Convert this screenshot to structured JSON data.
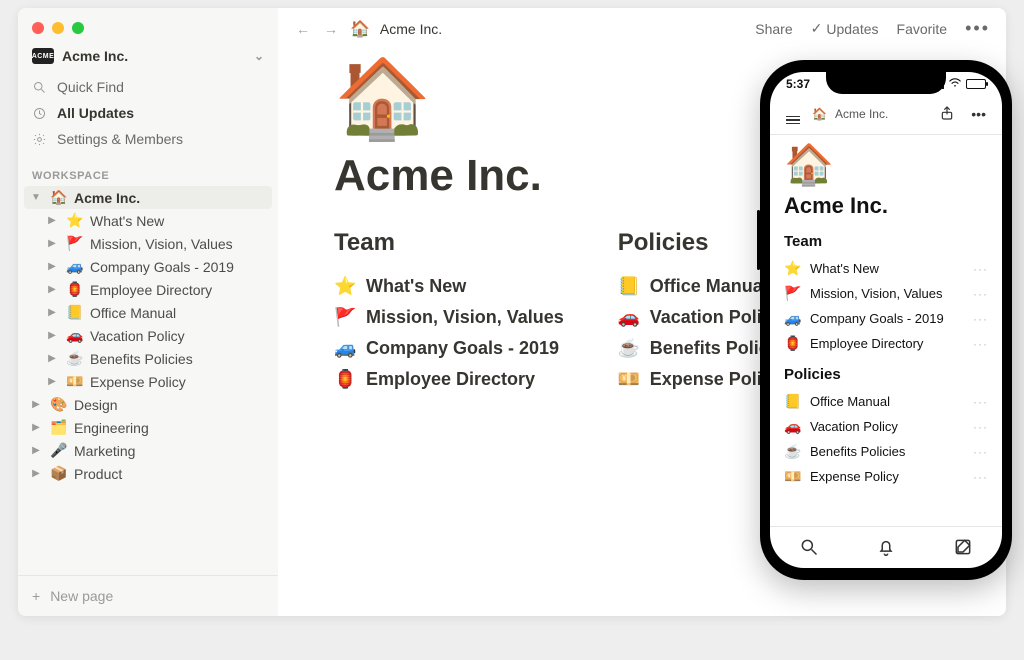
{
  "workspace": {
    "badge_text": "ACME",
    "name": "Acme Inc."
  },
  "sidebar_nav": {
    "quick_find": "Quick Find",
    "all_updates": "All Updates",
    "settings": "Settings & Members"
  },
  "section_label": "WORKSPACE",
  "tree": {
    "root": {
      "icon": "🏠",
      "label": "Acme Inc."
    },
    "children": [
      {
        "icon": "⭐",
        "label": "What's New"
      },
      {
        "icon": "🚩",
        "label": "Mission, Vision, Values"
      },
      {
        "icon": "🚙",
        "label": "Company Goals - 2019"
      },
      {
        "icon": "🏮",
        "label": "Employee Directory"
      },
      {
        "icon": "📒",
        "label": "Office Manual"
      },
      {
        "icon": "🚗",
        "label": "Vacation Policy"
      },
      {
        "icon": "☕",
        "label": "Benefits Policies"
      },
      {
        "icon": "💴",
        "label": "Expense Policy"
      }
    ],
    "siblings": [
      {
        "icon": "🎨",
        "label": "Design"
      },
      {
        "icon": "🗂️",
        "label": "Engineering"
      },
      {
        "icon": "🎤",
        "label": "Marketing"
      },
      {
        "icon": "📦",
        "label": "Product"
      }
    ]
  },
  "new_page": "New page",
  "topbar": {
    "breadcrumb_icon": "🏠",
    "breadcrumb": "Acme Inc.",
    "share": "Share",
    "updates": "Updates",
    "favorite": "Favorite"
  },
  "page": {
    "emoji": "🏠",
    "title": "Acme Inc.",
    "columns": [
      {
        "heading": "Team",
        "links": [
          {
            "icon": "⭐",
            "label": "What's New"
          },
          {
            "icon": "🚩",
            "label": "Mission, Vision, Values"
          },
          {
            "icon": "🚙",
            "label": "Company Goals - 2019"
          },
          {
            "icon": "🏮",
            "label": "Employee Directory"
          }
        ]
      },
      {
        "heading": "Policies",
        "links": [
          {
            "icon": "📒",
            "label": "Office Manual"
          },
          {
            "icon": "🚗",
            "label": "Vacation Policy"
          },
          {
            "icon": "☕",
            "label": "Benefits Policies"
          },
          {
            "icon": "💴",
            "label": "Expense Policy"
          }
        ]
      }
    ]
  },
  "phone": {
    "time": "5:37",
    "breadcrumb_icon": "🏠",
    "breadcrumb": "Acme Inc.",
    "emoji": "🏠",
    "title": "Acme Inc.",
    "sections": [
      {
        "heading": "Team",
        "links": [
          {
            "icon": "⭐",
            "label": "What's New"
          },
          {
            "icon": "🚩",
            "label": "Mission, Vision, Values"
          },
          {
            "icon": "🚙",
            "label": "Company Goals - 2019"
          },
          {
            "icon": "🏮",
            "label": "Employee Directory"
          }
        ]
      },
      {
        "heading": "Policies",
        "links": [
          {
            "icon": "📒",
            "label": "Office Manual"
          },
          {
            "icon": "🚗",
            "label": "Vacation Policy"
          },
          {
            "icon": "☕",
            "label": "Benefits Policies"
          },
          {
            "icon": "💴",
            "label": "Expense Policy"
          }
        ]
      }
    ]
  }
}
